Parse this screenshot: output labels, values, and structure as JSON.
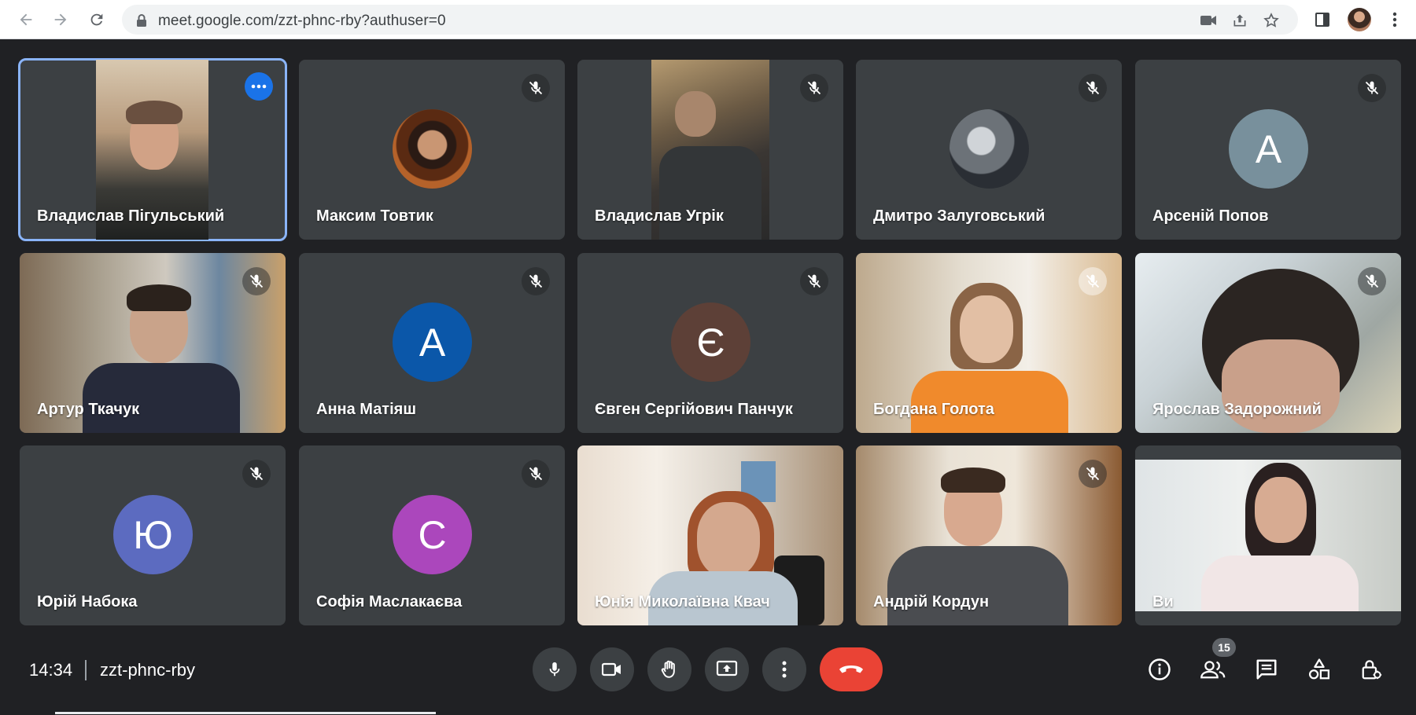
{
  "browser": {
    "url": "meet.google.com/zzt-phnc-rby?authuser=0"
  },
  "tiles": [
    {
      "name": "Владислав Пігульський",
      "type": "video",
      "active": true
    },
    {
      "name": "Максим Товтик",
      "type": "photo"
    },
    {
      "name": "Владислав Угрік",
      "type": "video"
    },
    {
      "name": "Дмитро Залуговський",
      "type": "photo"
    },
    {
      "name": "Арсеній Попов",
      "type": "letter",
      "letter": "А",
      "color": "#78909c"
    },
    {
      "name": "Артур Ткачук",
      "type": "video"
    },
    {
      "name": "Анна Матіяш",
      "type": "letter",
      "letter": "А",
      "color": "#0b57a9"
    },
    {
      "name": "Євген Сергійович Панчук",
      "type": "letter",
      "letter": "Є",
      "color": "#5d4037"
    },
    {
      "name": "Богдана Голота",
      "type": "video"
    },
    {
      "name": "Ярослав Задорожний",
      "type": "video"
    },
    {
      "name": "Юрій Набока",
      "type": "letter",
      "letter": "Ю",
      "color": "#5c6bc0"
    },
    {
      "name": "Софія Маслакаєва",
      "type": "letter",
      "letter": "С",
      "color": "#ab47bc"
    },
    {
      "name": "Юнія Миколаївна Квач",
      "type": "video"
    },
    {
      "name": "Андрій Кордун",
      "type": "video"
    },
    {
      "name": "Ви",
      "type": "video"
    }
  ],
  "bottom": {
    "time": "14:34",
    "meeting_code": "zzt-phnc-rby",
    "participants_count": "15"
  },
  "colors": {
    "background": "#202124",
    "tile": "#3c4043",
    "end_call": "#ea4335",
    "accent": "#1a73e8",
    "active_outline": "#8ab4f8"
  },
  "icons": [
    "back-icon",
    "forward-icon",
    "reload-icon",
    "lock-icon",
    "camera-blocked-icon",
    "share-icon",
    "star-icon",
    "side-panel-icon",
    "kebab-menu-icon",
    "mic-off-icon",
    "more-options-icon",
    "mic-icon",
    "camera-icon",
    "raise-hand-icon",
    "present-icon",
    "more-vert-icon",
    "end-call-icon",
    "info-icon",
    "people-icon",
    "chat-icon",
    "activities-icon",
    "host-controls-icon"
  ]
}
